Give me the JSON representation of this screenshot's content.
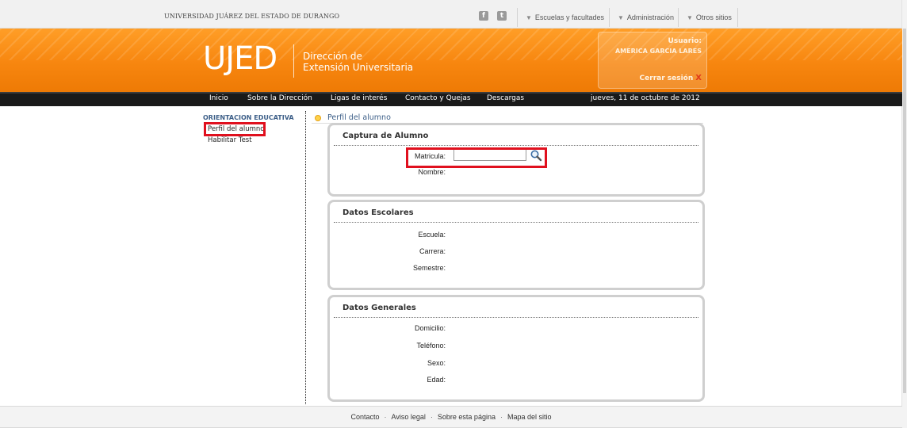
{
  "topbar": {
    "university": "UNIVERSIDAD JUÁREZ DEL ESTADO DE DURANGO",
    "facebook_icon": "f",
    "twitter_icon": "t",
    "nav": [
      "Escuelas y facultades",
      "Administración",
      "Otros sitios"
    ]
  },
  "banner": {
    "logo": "UJED",
    "subtitle_line1": "Dirección de",
    "subtitle_line2": "Extensión Universitaria",
    "user_label": "Usuario:",
    "user_name": "AMERICA GARCIA LARES",
    "logout": "Cerrar sesión",
    "logout_icon": "X"
  },
  "navbar": {
    "items": [
      "Inicio",
      "Sobre la Dirección",
      "Ligas de interés",
      "Contacto y Quejas",
      "Descargas"
    ],
    "date": "jueves, 11 de octubre de 2012"
  },
  "sidebar": {
    "title": "ORIENTACION EDUCATIVA",
    "items": [
      "Perfil del alumno",
      "Habilitar Test"
    ]
  },
  "breadcrumb": "Perfil del alumno",
  "panels": {
    "captura": {
      "title": "Captura de Alumno",
      "matricula_label": "Matricula:",
      "matricula_value": "",
      "nombre_label": "Nombre:"
    },
    "escolares": {
      "title": "Datos Escolares",
      "labels": [
        "Escuela:",
        "Carrera:",
        "Semestre:"
      ]
    },
    "generales": {
      "title": "Datos Generales",
      "labels": [
        "Domicilio:",
        "Teléfono:",
        "Sexo:",
        "Edad:"
      ]
    }
  },
  "footer": {
    "links": [
      "Contacto",
      "Aviso legal",
      "Sobre esta página",
      "Mapa del sitio"
    ],
    "separator": "·"
  },
  "colors": {
    "accent_orange": "#f7860f",
    "nav_dark": "#1a1a1a",
    "link_blue": "#3d5f88",
    "highlight_red": "#e0101e"
  }
}
